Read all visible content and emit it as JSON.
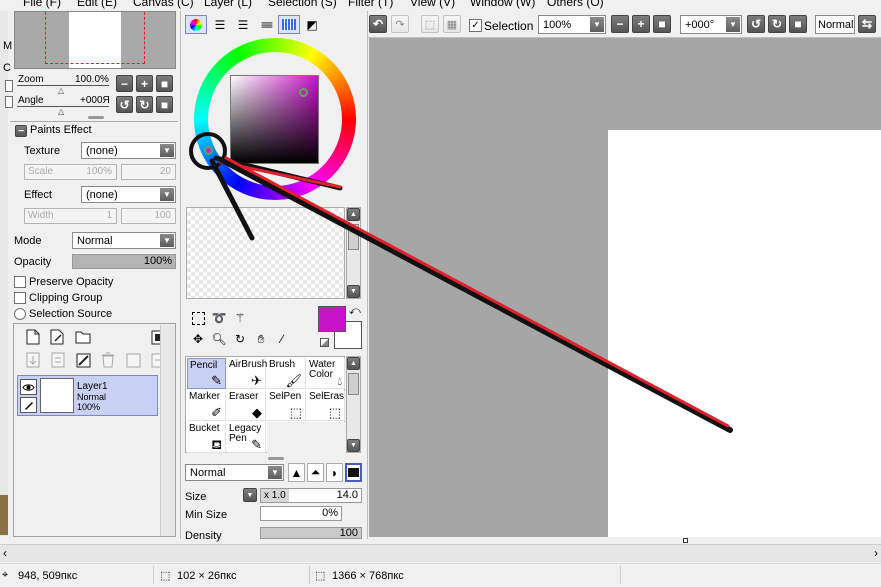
{
  "menu": [
    {
      "label": "File (F)"
    },
    {
      "label": "Edit (E)"
    },
    {
      "label": "Canvas (C)"
    },
    {
      "label": "Layer (L)"
    },
    {
      "label": "Selection (S)"
    },
    {
      "label": "Filter (T)"
    },
    {
      "label": "View (V)"
    },
    {
      "label": "Window (W)"
    },
    {
      "label": "Others (O)"
    }
  ],
  "navigator": {
    "zoom_label": "Zoom",
    "zoom_value": "100.0%",
    "angle_label": "Angle",
    "angle_value": "+000Я",
    "side_letters": [
      "M",
      "C"
    ]
  },
  "paints_effect": {
    "title": "Paints Effect",
    "texture_label": "Texture",
    "texture_value": "(none)",
    "scale_label": "Scale",
    "scale_pct": "100%",
    "scale_value": "20",
    "effect_label": "Effect",
    "effect_value": "(none)",
    "width_label": "Width",
    "width_value": "1",
    "width_max": "100"
  },
  "layer_props": {
    "mode_label": "Mode",
    "mode_value": "Normal",
    "opacity_label": "Opacity",
    "opacity_value": "100%",
    "opacity_level": 1.0,
    "preserve_opacity": "Preserve Opacity",
    "clipping_group": "Clipping Group",
    "selection_source": "Selection Source"
  },
  "layer": {
    "name": "Layer1",
    "mode": "Normal",
    "opacity": "100%"
  },
  "toolbar": {
    "selection_label": "Selection",
    "selection_checked": true,
    "zoom_value": "100%",
    "angle_value": "+000°",
    "mode_value": "Normal",
    "minus_glyph": "−",
    "plus_glyph": "+"
  },
  "tools": [
    {
      "label": "Pencil",
      "icon": "pencil-icon",
      "selected": true
    },
    {
      "label": "AirBrush",
      "icon": "airbrush-icon"
    },
    {
      "label": "Brush",
      "icon": "brush-icon"
    },
    {
      "label": "Water Color",
      "icon": "watercolor-icon"
    },
    {
      "label": "Marker",
      "icon": "marker-icon"
    },
    {
      "label": "Eraser",
      "icon": "eraser-icon"
    },
    {
      "label": "SelPen",
      "icon": "selpen-icon"
    },
    {
      "label": "SelEras",
      "icon": "seleras-icon"
    },
    {
      "label": "Bucket",
      "icon": "bucket-icon"
    },
    {
      "label": "Legacy Pen",
      "icon": "legacy-pen-icon"
    }
  ],
  "brush_settings": {
    "blend_mode": "Normal",
    "size_label": "Size",
    "size_multiplier": "x 1.0",
    "size_value": "14.0",
    "min_size_label": "Min Size",
    "min_size_value": "0%",
    "density_label": "Density",
    "density_value": "100"
  },
  "colors": {
    "primary": "#c814c8",
    "secondary": "#ffffff",
    "accent_red": "#e0202a",
    "selection_blue": "#c8d0f4"
  },
  "status": {
    "cursor": "948, 509пкс",
    "selection_size": "102 × 26пкс",
    "canvas_size": "1366 × 768пкс"
  }
}
